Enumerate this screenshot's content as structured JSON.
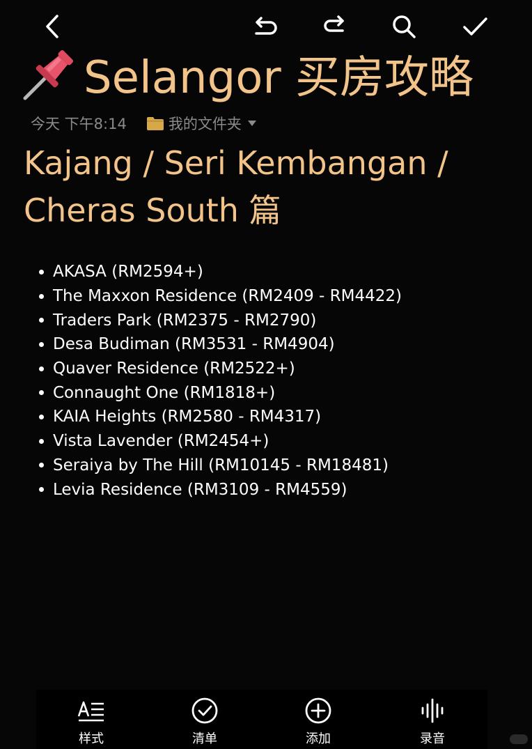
{
  "topbar": {
    "back_icon": "chevron-left-icon",
    "undo_icon": "undo-icon",
    "redo_icon": "redo-icon",
    "search_icon": "search-icon",
    "done_icon": "check-icon"
  },
  "note": {
    "title_emoji_icon": "pushpin-icon",
    "title": "Selangor 买房攻略",
    "time": "今天 下午8:14",
    "folder": "我的文件夹",
    "subtitle": "Kajang / Seri Kembangan / Cheras South 篇",
    "items": [
      "AKASA (RM2594+)",
      "The Maxxon Residence (RM2409 - RM4422)",
      "Traders Park (RM2375 - RM2790)",
      "Desa Budiman (RM3531 - RM4904)",
      "Quaver Residence (RM2522+)",
      "Connaught One (RM1818+)",
      "KAIA Heights (RM2580 - RM4317)",
      "Vista Lavender (RM2454+)",
      "Seraiya by The Hill (RM10145 - RM18481)",
      "Levia Residence (RM3109 - RM4559)"
    ]
  },
  "bottombar": {
    "style_label": "样式",
    "checklist_label": "清单",
    "add_label": "添加",
    "record_label": "录音"
  },
  "colors": {
    "background": "#060606",
    "title_accent": "#f2c48a",
    "meta_text": "#8b8b8b",
    "folder_icon": "#d6a84a"
  }
}
